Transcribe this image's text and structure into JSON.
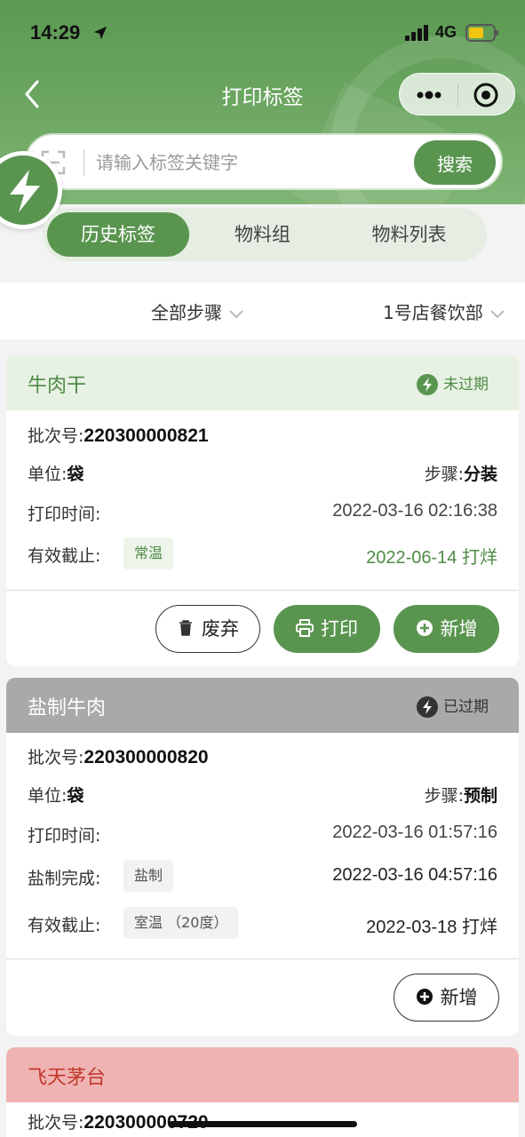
{
  "status": {
    "time": "14:29",
    "network": "4G"
  },
  "nav": {
    "title": "打印标签"
  },
  "search": {
    "placeholder": "请输入标签关键字",
    "button": "搜索"
  },
  "tabs": [
    {
      "label": "历史标签"
    },
    {
      "label": "物料组"
    },
    {
      "label": "物料列表"
    }
  ],
  "filters": {
    "step": "全部步骤",
    "store": "1号店餐饮部"
  },
  "cards": [
    {
      "name": "牛肉干",
      "status": "未过期",
      "batch_label": "批次号:",
      "batch": "220300000821",
      "unit_label": "单位:",
      "unit": "袋",
      "step_label": "步骤:",
      "step": "分装",
      "print_time_label": "打印时间:",
      "print_time": "2022-03-16 02:16:38",
      "expire_label": "有效截止:",
      "storage": "常温",
      "expire": "2022-06-14 打烊",
      "buttons": {
        "discard": "废弃",
        "print": "打印",
        "add": "新增"
      }
    },
    {
      "name": "盐制牛肉",
      "status": "已过期",
      "batch_label": "批次号:",
      "batch": "220300000820",
      "unit_label": "单位:",
      "unit": "袋",
      "step_label": "步骤:",
      "step": "预制",
      "print_time_label": "打印时间:",
      "print_time": "2022-03-16 01:57:16",
      "salt_label": "盐制完成:",
      "salt_tag": "盐制",
      "salt_time": "2022-03-16 04:57:16",
      "expire_label": "有效截止:",
      "storage": "室温 （20度）",
      "expire": "2022-03-18 打烊",
      "buttons": {
        "add": "新增"
      }
    },
    {
      "name": "飞天茅台",
      "batch_label": "批次号:",
      "batch": "220300000720"
    }
  ],
  "colors": {
    "brand_green": "#5a9550",
    "fresh_head": "#e8f2e4",
    "expired_head": "#a9a9a9",
    "alert_head": "#f0b3b3",
    "alert_text": "#c0392b"
  }
}
